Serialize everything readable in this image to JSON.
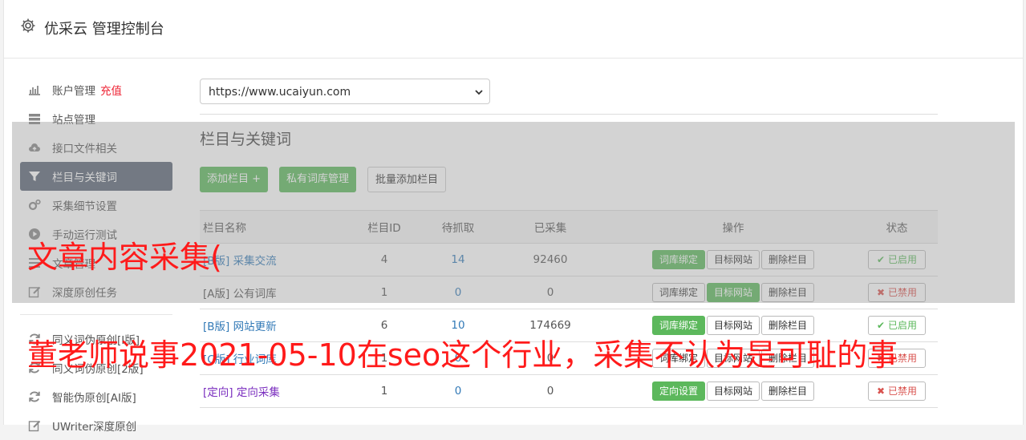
{
  "header": {
    "title": "优采云 管理控制台",
    "icon": "gear-icon"
  },
  "sidebar": {
    "items": [
      {
        "label": "账户管理",
        "badge": "充值",
        "icon": "bar-chart-icon"
      },
      {
        "label": "站点管理",
        "icon": "server-icon"
      },
      {
        "label": "接口文件相关",
        "icon": "cloud-upload-icon"
      },
      {
        "label": "栏目与关键词",
        "icon": "filter-icon",
        "active": true
      },
      {
        "label": "采集细节设置",
        "icon": "gears-icon"
      },
      {
        "label": "手动运行测试",
        "icon": "play-circle-icon"
      },
      {
        "label": "文章管理",
        "icon": "list-icon"
      },
      {
        "label": "深度原创任务",
        "icon": "edit-icon"
      }
    ],
    "items2": [
      {
        "label": "同义词伪原创[I版]",
        "icon": "refresh-icon"
      },
      {
        "label": "同义词伪原创[2版]",
        "icon": "refresh-icon"
      },
      {
        "label": "智能伪原创[AI版]",
        "icon": "refresh-icon"
      },
      {
        "label": "UWriter深度原创",
        "icon": "edit-icon"
      }
    ]
  },
  "site_select": {
    "value": "https://www.ucaiyun.com"
  },
  "page_title": "栏目与关键词",
  "buttons": {
    "add": "添加栏目 +",
    "private": "私有词库管理",
    "batch": "批量添加栏目"
  },
  "table": {
    "headers": [
      "栏目名称",
      "栏目ID",
      "待抓取",
      "已采集",
      "操作",
      "状态"
    ],
    "rows": [
      {
        "prefix": "[B版]",
        "name": "采集交流",
        "id": "4",
        "pending": "14",
        "collected": "92460",
        "op1": "词库绑定",
        "op1_green": true,
        "op2": "目标网站",
        "op2_green": false,
        "op3": "删除栏目",
        "status": "已启用",
        "status_on": true
      },
      {
        "prefix": "[A版]",
        "name": "公有词库",
        "id": "1",
        "pending": "0",
        "collected": "0",
        "op1": "词库绑定",
        "op1_green": false,
        "op2": "目标网站",
        "op2_green": true,
        "op3": "删除栏目",
        "status": "已禁用",
        "status_on": false
      },
      {
        "prefix": "[B版]",
        "name": "网站更新",
        "id": "6",
        "pending": "10",
        "collected": "174669",
        "op1": "词库绑定",
        "op1_green": true,
        "op2": "目标网站",
        "op2_green": false,
        "op3": "删除栏目",
        "status": "已启用",
        "status_on": true
      },
      {
        "prefix": "[C版]",
        "name": "行业词库",
        "id": "1",
        "pending": "0",
        "collected": "0",
        "op1": "词库绑定",
        "op1_green": false,
        "op2": "目标网站",
        "op2_green": false,
        "op3": "删除栏目",
        "status": "已禁用",
        "status_on": false
      },
      {
        "prefix": "[定向]",
        "name": "定向采集",
        "id": "1",
        "pending": "0",
        "collected": "0",
        "op1": "定向设置",
        "op1_green": true,
        "op2": "目标网站",
        "op2_green": false,
        "op3": "删除栏目",
        "status": "已禁用",
        "status_on": false
      }
    ]
  },
  "watermark": {
    "line1": "文章内容采集(",
    "line2": "董老师说事2021-05-10在seo这个行业，采集不认为是可耻的事"
  },
  "colors": {
    "green": "#5cb85c",
    "red": "#d9534f",
    "link": "#337ab7",
    "active_nav": "#5b6575",
    "watermark": "#ff1a1a"
  }
}
